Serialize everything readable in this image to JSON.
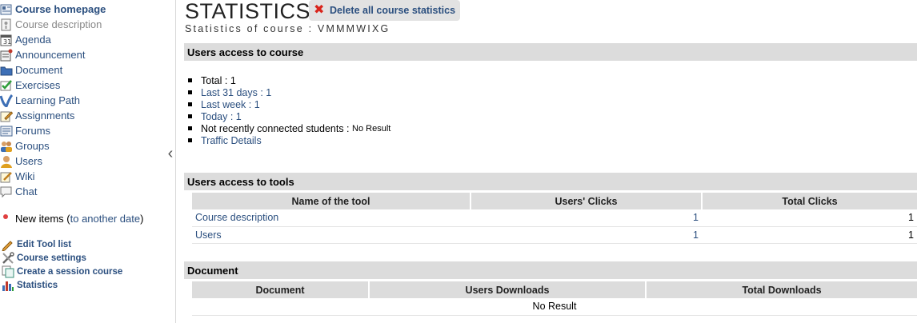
{
  "sidebar": {
    "items": [
      {
        "label": "Course homepage",
        "icon": "home-icon"
      },
      {
        "label": "Course description",
        "icon": "info-icon"
      },
      {
        "label": "Agenda",
        "icon": "calendar-icon"
      },
      {
        "label": "Announcement",
        "icon": "announcement-icon"
      },
      {
        "label": "Document",
        "icon": "folder-icon"
      },
      {
        "label": "Exercises",
        "icon": "checkmark-icon"
      },
      {
        "label": "Learning Path",
        "icon": "path-icon"
      },
      {
        "label": "Assignments",
        "icon": "pencil-icon"
      },
      {
        "label": "Forums",
        "icon": "forum-icon"
      },
      {
        "label": "Groups",
        "icon": "group-icon"
      },
      {
        "label": "Users",
        "icon": "user-icon"
      },
      {
        "label": "Wiki",
        "icon": "wiki-icon"
      },
      {
        "label": "Chat",
        "icon": "chat-icon"
      }
    ],
    "new_items": {
      "label": "New items (",
      "link": "to another date",
      "suffix": ")"
    },
    "admin": [
      {
        "label": "Edit Tool list",
        "icon": "pencil-icon"
      },
      {
        "label": "Course settings",
        "icon": "tools-icon"
      },
      {
        "label": "Create a session course",
        "icon": "copy-icon"
      },
      {
        "label": "Statistics",
        "icon": "bar-chart-icon"
      }
    ]
  },
  "header": {
    "title": "STATISTICS",
    "delete_label": "Delete all course statistics",
    "subtitle": "Statistics of course : VMMMWIXG"
  },
  "access": {
    "title": "Users access to course",
    "total": "Total : 1",
    "last31": "Last 31 days : 1",
    "lastweek": "Last week : 1",
    "today": "Today : 1",
    "not_connected_label": "Not recently connected students : ",
    "not_connected_value": "No Result",
    "traffic": "Traffic Details"
  },
  "tools": {
    "title": "Users access to tools",
    "headers": [
      "Name of the tool",
      "Users' Clicks",
      "Total Clicks"
    ],
    "rows": [
      {
        "name": "Course description",
        "users": "1",
        "total": "1"
      },
      {
        "name": "Users",
        "users": "1",
        "total": "1"
      }
    ]
  },
  "documents": {
    "title": "Document",
    "headers": [
      "Document",
      "Users Downloads",
      "Total Downloads"
    ],
    "empty": "No Result"
  },
  "colors": {
    "link": "#2b4f7f",
    "section_bg": "#dcdcdc",
    "delete_icon": "#d9251c"
  }
}
